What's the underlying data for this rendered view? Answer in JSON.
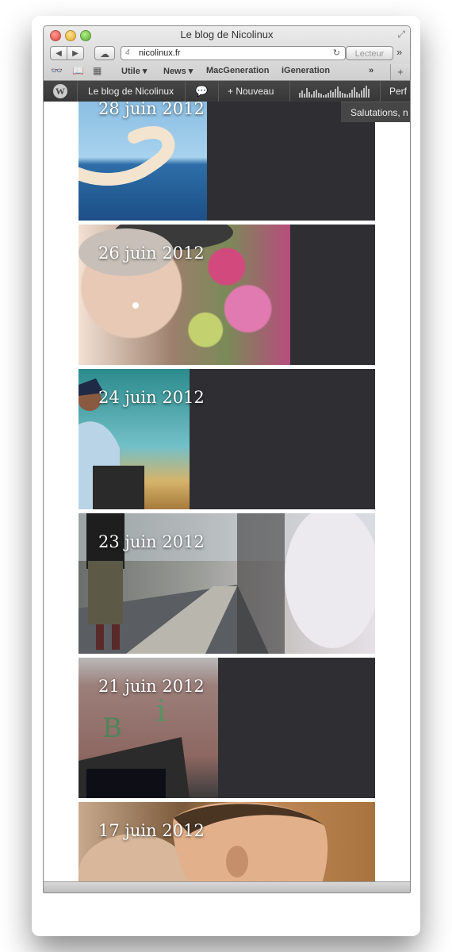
{
  "window": {
    "title": "Le blog de Nicolinux"
  },
  "toolbar": {
    "back": "◀",
    "forward": "▶",
    "cloud": "☁",
    "address": "nicolinux.fr",
    "address_icon": "4",
    "reload": "↻",
    "reader": "Lecteur",
    "more": "»"
  },
  "bookmarks": {
    "icons": [
      "reading-list-icon",
      "bookmarks-icon",
      "top-sites-icon"
    ],
    "items": [
      "Utile ▾",
      "News ▾",
      "MacGeneration",
      "iGeneration"
    ],
    "overflow": "»",
    "new_tab": "+"
  },
  "adminbar": {
    "site": "Le blog de Nicolinux",
    "comments": "💬",
    "new": "+ Nouveau",
    "perf": "Perf",
    "greeting": "Salutations, n"
  },
  "posts": [
    {
      "date": "28 juin 2012",
      "image": "boomerang over sea"
    },
    {
      "date": "26 juin 2012",
      "image": "woman with hat and flowers"
    },
    {
      "date": "24 juin 2012",
      "image": "man with backpack"
    },
    {
      "date": "23 juin 2012",
      "image": "street scene"
    },
    {
      "date": "21 juin 2012",
      "image": "building wall with letters"
    },
    {
      "date": "17 juin 2012",
      "image": "man profile"
    }
  ]
}
